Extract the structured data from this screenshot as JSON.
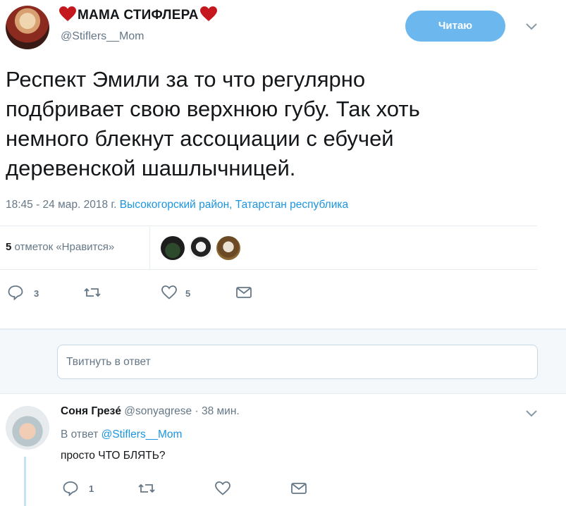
{
  "tweet": {
    "author_name": "МАМА СТИФЛЕРА",
    "author_handle": "@Stiflers__Mom",
    "follow_label": "Читаю",
    "text_lines": [
      "Респект Эмили за то что регулярно",
      "подбривает свою верхнюю губу. Так хоть",
      "немного блекнут ассоциации с ебучей",
      "деревенской шашлычницей."
    ],
    "timestamp": "18:45 - 24 мар. 2018 г.",
    "location": "Высокогорский район, Татарстан республика",
    "likes_count": "5",
    "likes_label": "отметок «Нравится»",
    "reply_count": "3",
    "retweet_count": "",
    "like_action_count": "5"
  },
  "reply_composer": {
    "placeholder": "Твитнуть в ответ"
  },
  "reply": {
    "author_name": "Соня Грезé",
    "author_handle": "@sonyagrese",
    "time": "· 38 мин.",
    "in_reply_prefix": "В ответ",
    "in_reply_handle": "@Stiflers__Mom",
    "text": "просто ЧТО БЛЯТЬ?",
    "reply_count": "1"
  },
  "colors": {
    "accent": "#1b95e0",
    "follow_button": "#6cb7ee",
    "heart": "#c4181e",
    "muted": "#657786",
    "divider": "#e6ecf0"
  }
}
